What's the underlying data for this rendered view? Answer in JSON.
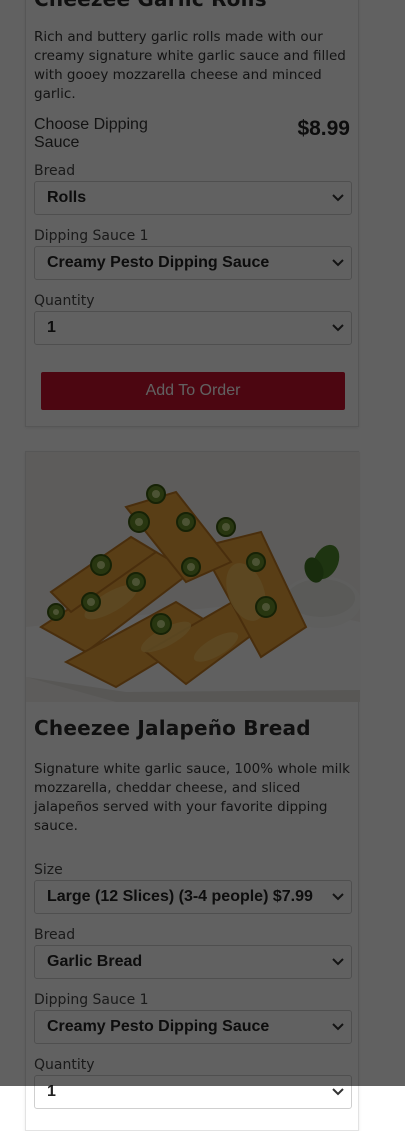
{
  "item1": {
    "title": "Cheezee Garlic Rolls",
    "description": "Rich and buttery garlic rolls made with our creamy signature white garlic sauce and filled with gooey mozzarella cheese and minced garlic.",
    "choose_label": "Choose Dipping Sauce",
    "price": "$8.99",
    "fields": [
      {
        "label": "Bread",
        "value": "Rolls"
      },
      {
        "label": "Dipping Sauce 1",
        "value": "Creamy Pesto Dipping Sauce"
      },
      {
        "label": "Quantity",
        "value": "1"
      }
    ],
    "add_button": "Add To Order"
  },
  "item2": {
    "image_alt": "Cheezee jalapeño bread slices with cheese and jalapeños on a white plate with dipping sauce",
    "title": "Cheezee Jalapeño Bread",
    "description": "Signature white garlic sauce, 100% whole milk mozzarella, cheddar cheese, and sliced jalapeños served with your favorite dipping sauce.",
    "fields": [
      {
        "label": "Size",
        "value": "Large (12 Slices) (3-4 people) $7.99"
      },
      {
        "label": "Bread",
        "value": "Garlic Bread"
      },
      {
        "label": "Dipping Sauce 1",
        "value": "Creamy Pesto Dipping Sauce"
      },
      {
        "label": "Quantity",
        "value": "1"
      }
    ]
  },
  "icons": {
    "select_arrow": "chevron-down-icon"
  },
  "colors": {
    "accent": "#c8102e",
    "overlay": "rgba(0,0,0,0.62)"
  }
}
